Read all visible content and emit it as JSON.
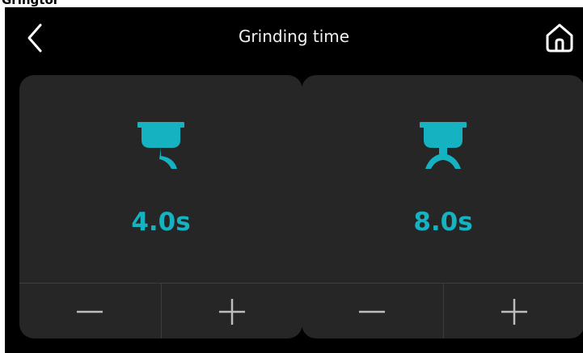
{
  "top_strip": {
    "text": "Gringtor"
  },
  "header": {
    "title": "Grinding time",
    "back_icon": "chevron-left-icon",
    "home_icon": "home-icon"
  },
  "theme": {
    "accent": "#15b2c2",
    "background": "#000000",
    "card": "#262626",
    "text": "#f2f2f2",
    "divider": "#3d3d3d"
  },
  "cards": [
    {
      "icon": "single-spout-portafilter-icon",
      "value": "4.0s",
      "decrease_icon": "minus-icon",
      "increase_icon": "plus-icon"
    },
    {
      "icon": "double-spout-portafilter-icon",
      "value": "8.0s",
      "decrease_icon": "minus-icon",
      "increase_icon": "plus-icon"
    }
  ]
}
